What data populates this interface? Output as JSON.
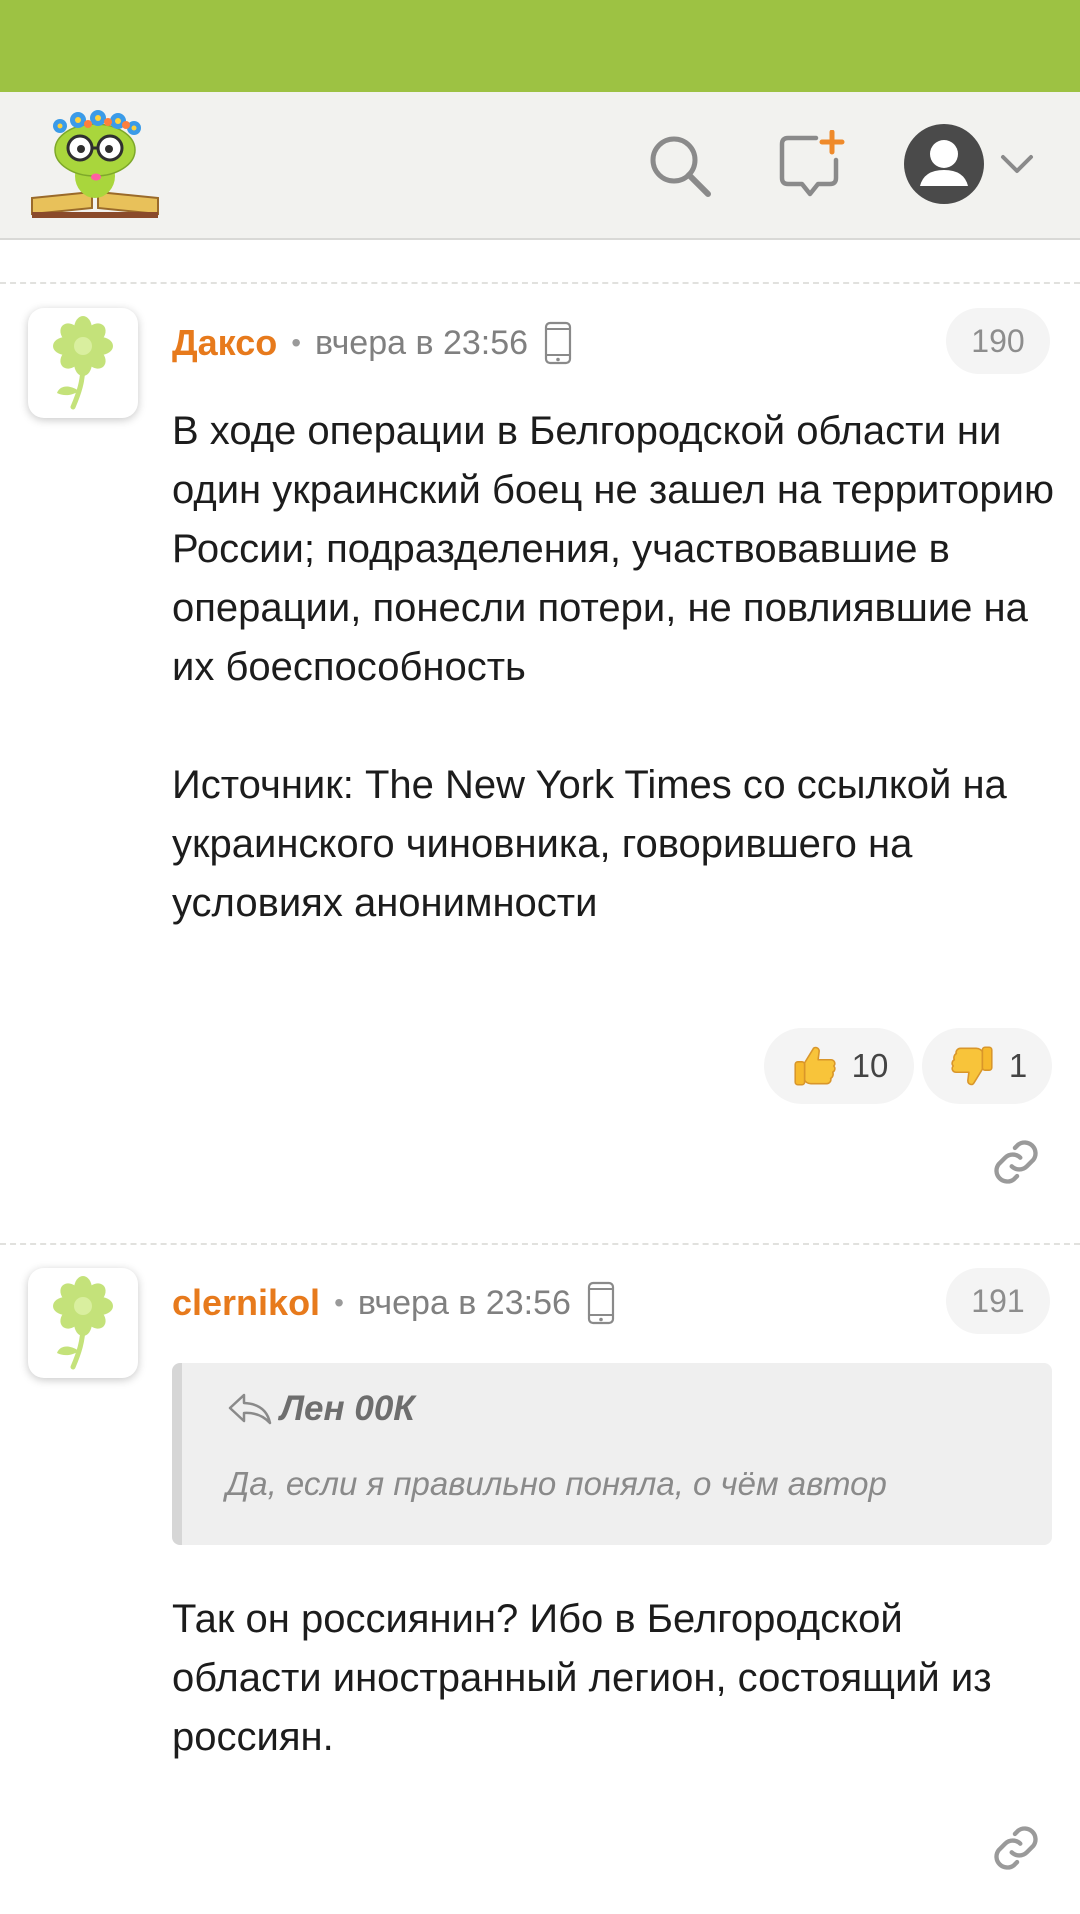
{
  "colors": {
    "status_bar": "#9dc243",
    "header_bg": "#f2f2ef",
    "author": "#e77a1c",
    "meta": "#808080"
  },
  "header": {
    "logo_icon": "bookworm-logo",
    "search_icon": "search-icon",
    "new_post_icon": "new-post-icon",
    "profile_icon": "user-avatar-icon",
    "dropdown_icon": "chevron-down-icon"
  },
  "comments": [
    {
      "avatar_icon": "flower-avatar",
      "author": "Даксо",
      "separator": "•",
      "time": "вчера в 23:56",
      "device_icon": "phone-icon",
      "number": "190",
      "paragraphs": [
        "В ходе операции в Белгородской области ни один украинский боец не зашел на территорию России; подразделения, участвовавшие в операции, понесли потери, не повлиявшие на их боеспособность",
        "Источник: The New York Times со ссылкой на украинского чиновника, говорившего на условиях анонимности"
      ],
      "likes": "10",
      "dislikes": "1",
      "link_icon": "link-icon"
    },
    {
      "avatar_icon": "flower-avatar",
      "author": "clernikol",
      "separator": "•",
      "time": "вчера в 23:56",
      "device_icon": "phone-icon",
      "number": "191",
      "quote": {
        "author": "Лен 00К",
        "text": "Да, если я правильно поняла, о чём автор"
      },
      "paragraphs": [
        "Так он россиянин? Ибо в Белгородской области иностранный легион, состоящий из россиян."
      ],
      "link_icon": "link-icon"
    }
  ]
}
